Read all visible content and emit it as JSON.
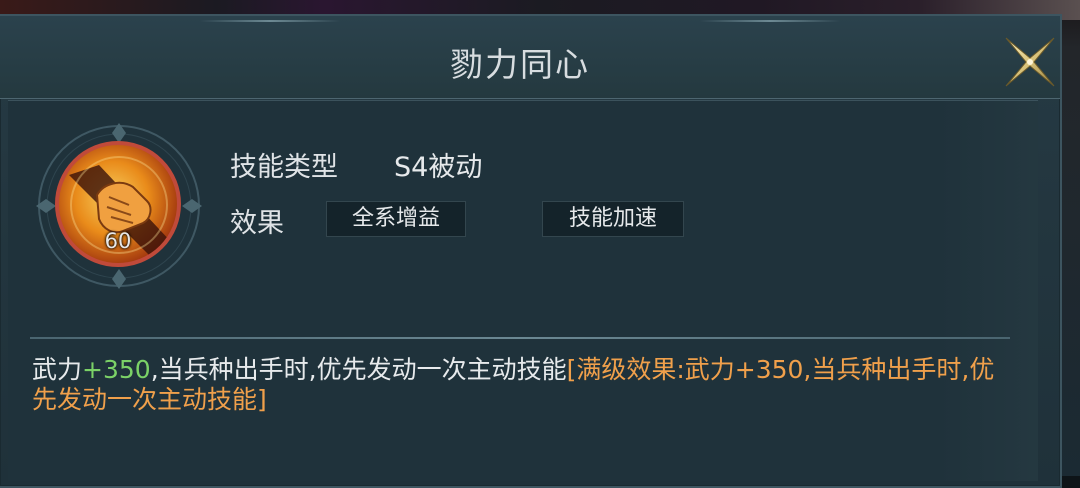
{
  "dialog": {
    "title": "勠力同心"
  },
  "skill": {
    "level": "60",
    "type_label": "技能类型",
    "type_value": "S4被动",
    "effect_label": "效果",
    "tags": [
      "全系增益",
      "技能加速"
    ]
  },
  "description": {
    "part1": "武力",
    "part2_green": "+350",
    "part3": ",当兵种出手时,优先发动一次主动技能",
    "part4_orange": "[满级效果:武力+350,当兵种出手时,优先发动一次主动技能]"
  },
  "colors": {
    "panel_bg": "#23363f",
    "accent_gold": "#d8c27a",
    "value_green": "#7bd267",
    "max_level_orange": "#f0a04b",
    "skill_border_red": "#c04a3a"
  },
  "icons": {
    "close": "close-x-icon",
    "skill": "fist-skill-icon"
  }
}
